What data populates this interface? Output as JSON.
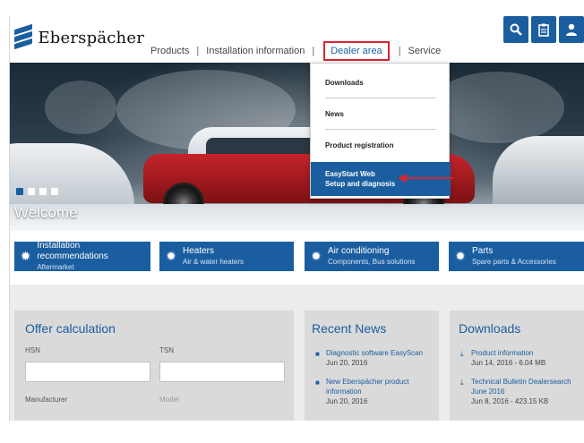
{
  "header": {
    "brand": "Eberspächer",
    "nav": [
      "Products",
      "Installation information",
      "Dealer area",
      "Service"
    ],
    "icons": [
      "search-icon",
      "clipboard-icon",
      "user-icon"
    ]
  },
  "hero": {
    "welcome": "Welcome",
    "slide_count": 4,
    "active_slide": 1
  },
  "dropdown": {
    "items": [
      "Downloads",
      "News",
      "Product registration"
    ],
    "active_title": "EasyStart Web",
    "active_sub": "Setup and diagnosis"
  },
  "categories": [
    {
      "title": "Installation recommendations",
      "sub": "Aftermarket"
    },
    {
      "title": "Heaters",
      "sub": "Air & water heaters"
    },
    {
      "title": "Air conditioning",
      "sub": "Components, Bus solutions"
    },
    {
      "title": "Parts",
      "sub": "Spare parts & Accessories"
    }
  ],
  "offer": {
    "title": "Offer calculation",
    "hsn_label": "HSN",
    "tsn_label": "TSN",
    "manufacturer_label": "Manufacturer",
    "model_label": "Model"
  },
  "news": {
    "title": "Recent News",
    "items": [
      {
        "title": "Diagnostic software EasyScan",
        "date": "Jun 20, 2016"
      },
      {
        "title": "New Eberspächer product information",
        "date": "Jun 20, 2016"
      }
    ]
  },
  "downloads": {
    "title": "Downloads",
    "items": [
      {
        "title": "Product information",
        "meta": "Jun 14, 2016 - 6.04 MB"
      },
      {
        "title": "Technical Bulletin Dealersearch June 2016",
        "meta": "Jun 8, 2016 - 423.15 KB"
      }
    ]
  },
  "colors": {
    "brand_blue": "#1b5ea0",
    "highlight_red": "#d8252f"
  }
}
